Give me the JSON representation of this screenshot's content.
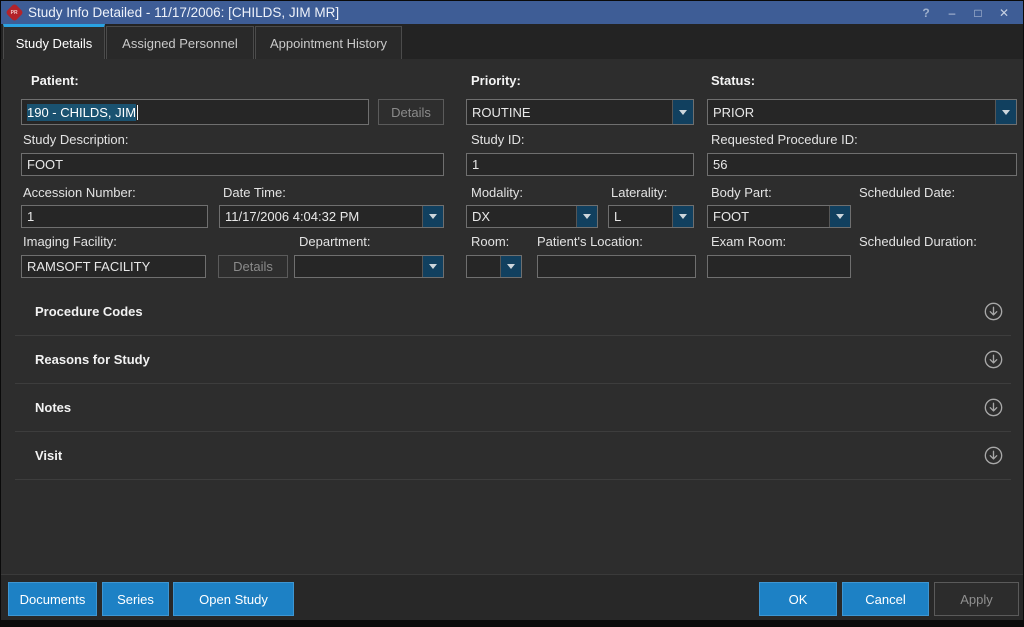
{
  "titlebar": {
    "title": "Study Info Detailed - 11/17/2006: [CHILDS, JIM MR]",
    "app_icon_text": "PR",
    "help": "?",
    "minimize": "–",
    "maximize": "□",
    "close": "✕"
  },
  "tabs": [
    {
      "label": "Study Details",
      "active": true
    },
    {
      "label": "Assigned Personnel",
      "active": false
    },
    {
      "label": "Appointment History",
      "active": false
    }
  ],
  "form": {
    "patient": {
      "label": "Patient:",
      "value": "190 - CHILDS, JIM",
      "details_label": "Details"
    },
    "priority": {
      "label": "Priority:",
      "value": "ROUTINE"
    },
    "status": {
      "label": "Status:",
      "value": "PRIOR"
    },
    "study_description": {
      "label": "Study Description:",
      "value": "FOOT"
    },
    "study_id": {
      "label": "Study ID:",
      "value": "1"
    },
    "requested_procedure_id": {
      "label": "Requested Procedure ID:",
      "value": "56"
    },
    "accession_number": {
      "label": "Accession Number:",
      "value": "1"
    },
    "date_time": {
      "label": "Date Time:",
      "value": "11/17/2006 4:04:32 PM"
    },
    "modality": {
      "label": "Modality:",
      "value": "DX"
    },
    "laterality": {
      "label": "Laterality:",
      "value": "L"
    },
    "body_part": {
      "label": "Body Part:",
      "value": "FOOT"
    },
    "scheduled_date": {
      "label": "Scheduled Date:"
    },
    "imaging_facility": {
      "label": "Imaging Facility:",
      "value": "RAMSOFT FACILITY",
      "details_label": "Details"
    },
    "department": {
      "label": "Department:",
      "value": ""
    },
    "room": {
      "label": "Room:",
      "value": ""
    },
    "patients_location": {
      "label": "Patient's Location:",
      "value": ""
    },
    "exam_room": {
      "label": "Exam Room:",
      "value": ""
    },
    "scheduled_duration": {
      "label": "Scheduled Duration:"
    }
  },
  "sections": [
    {
      "title": "Procedure Codes"
    },
    {
      "title": "Reasons for Study"
    },
    {
      "title": "Notes"
    },
    {
      "title": "Visit"
    }
  ],
  "footer": {
    "documents": "Documents",
    "series": "Series",
    "open_study": "Open Study",
    "ok": "OK",
    "cancel": "Cancel",
    "apply": "Apply"
  },
  "colors": {
    "titlebar": "#3e5d96",
    "tab_accent": "#2aa2e2",
    "button_blue": "#1d81c5",
    "combo_button": "#11405f",
    "selection": "#1a5270",
    "background": "#2d2d2d"
  }
}
